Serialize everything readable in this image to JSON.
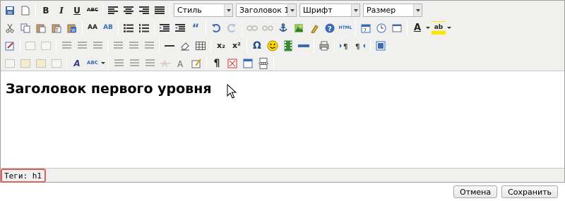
{
  "toolbar": {
    "row1": {
      "bold": "B",
      "italic": "I",
      "underline": "U",
      "strike": "ABC",
      "style_select": "Стиль",
      "format_select": "Заголовок 1",
      "font_select": "Шрифт",
      "size_select": "Размер"
    },
    "row2": {
      "find": "AA",
      "replace": "AB",
      "blockquote": "“",
      "html": "HTML",
      "help": "?",
      "text_color": "A",
      "highlight": "ab"
    },
    "row3": {
      "sub": "x₂",
      "sup": "x²",
      "omega": "Ω"
    },
    "row4": {
      "style_a": "A",
      "spell": "ABC",
      "pilcrow": "¶"
    }
  },
  "content": {
    "heading": "Заголовок первого уровня"
  },
  "status": {
    "path": "Теги: h1"
  },
  "buttons": {
    "cancel": "Отмена",
    "save": "Сохранить"
  },
  "colors": {
    "toolbar_bg": "#f0f0ee",
    "highlight_border": "#e06060"
  }
}
